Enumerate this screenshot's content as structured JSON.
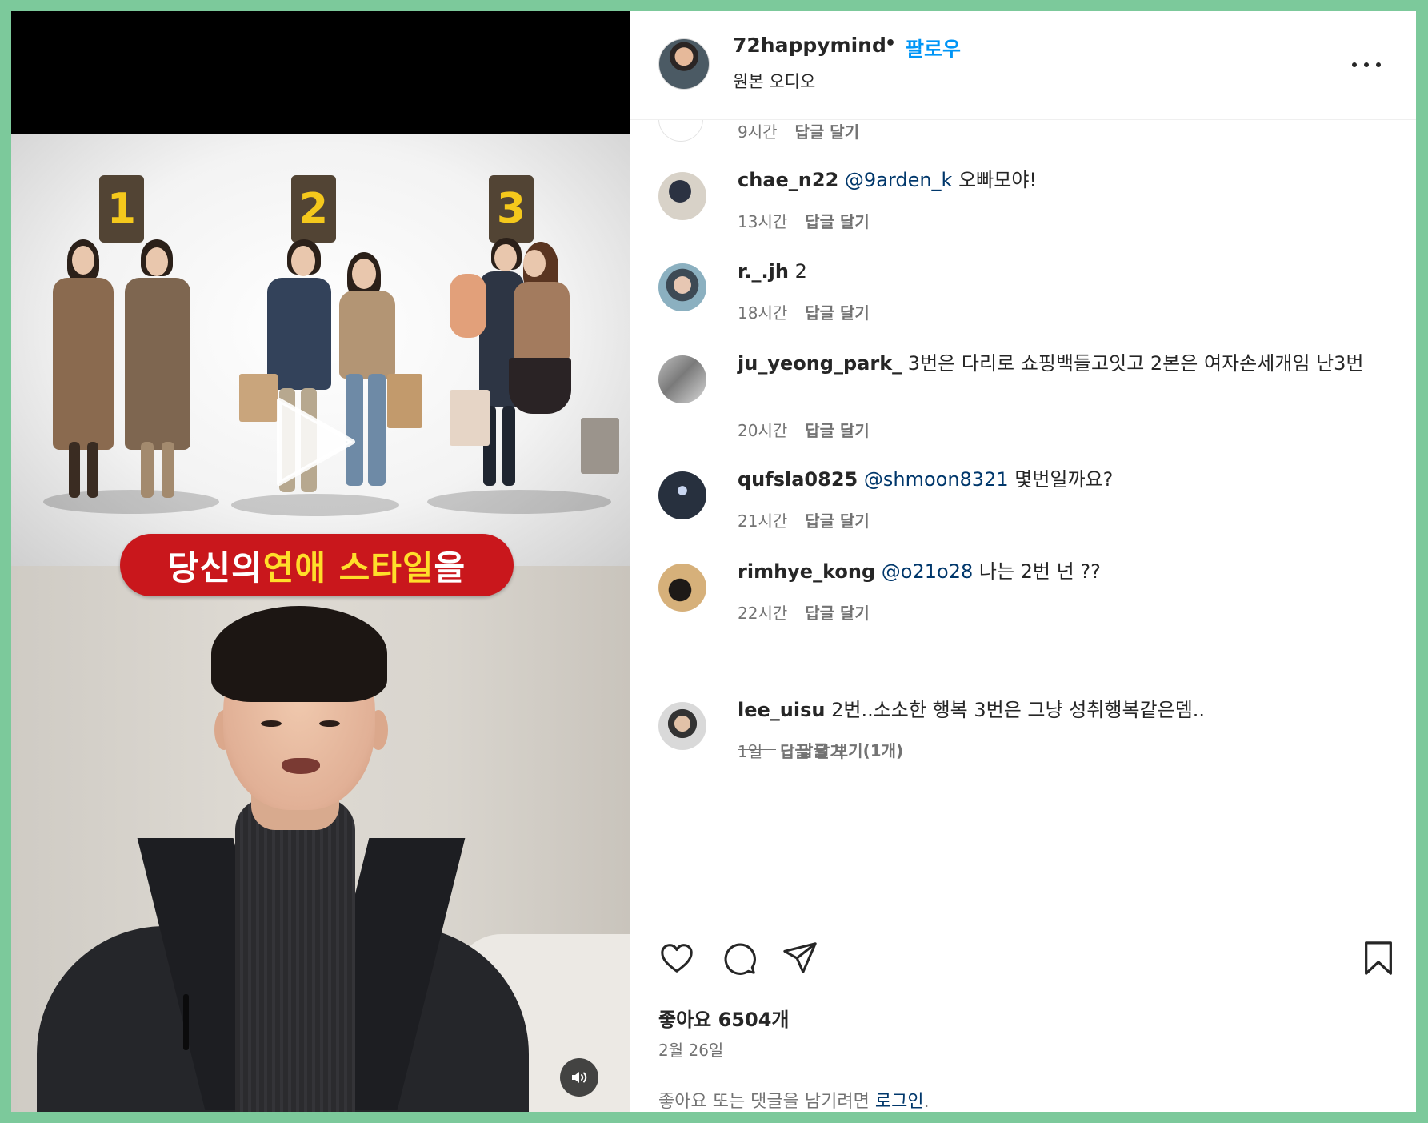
{
  "video": {
    "badges": [
      "1",
      "2",
      "3"
    ],
    "banner": {
      "part1": "당신의 ",
      "highlight": "연애 스타일",
      "part2": "을"
    }
  },
  "header": {
    "username": "72happymind",
    "separator": "•",
    "follow_label": "팔로우",
    "audio_label": "원본 오디오"
  },
  "comments": {
    "previous": {
      "time": "9시간",
      "reply_label": "답글 달기"
    },
    "items": [
      {
        "username": "chae_n22",
        "mention": "@9arden_k",
        "text": " 오빠모야!",
        "time": "13시간",
        "reply_label": "답글 달기"
      },
      {
        "username": "r._.jh",
        "mention": "",
        "text": " 2",
        "time": "18시간",
        "reply_label": "답글 달기"
      },
      {
        "username": "ju_yeong_park_",
        "mention": "",
        "text": " 3번은 다리로 쇼핑백들고잇고 2본은 여자손세개임 난3번",
        "time": "20시간",
        "reply_label": "답글 달기"
      },
      {
        "username": "qufsla0825",
        "mention": "@shmoon8321",
        "text": " 몇번일까요?",
        "time": "21시간",
        "reply_label": "답글 달기"
      },
      {
        "username": "rimhye_kong",
        "mention": "@o21o28",
        "text": " 나는 2번 넌 ??",
        "time": "22시간",
        "reply_label": "답글 달기"
      },
      {
        "username": "lee_uisu",
        "mention": "",
        "text": " 2번..소소한 행복 3번은 그냥 성취행복같은뎀..",
        "time": "1일",
        "reply_label": "답글 달기"
      }
    ],
    "view_replies_label": "답글 보기(1개)"
  },
  "actions": {
    "icons": [
      "heart-icon",
      "comment-icon",
      "share-icon",
      "bookmark-icon"
    ],
    "likes_label": "좋아요 6504개",
    "date": "2월 26일",
    "login_prompt": "좋아요 또는 댓글을 남기려면 ",
    "login_link": "로그인",
    "login_suffix": "."
  },
  "colors": {
    "follow_blue": "#0095f6",
    "mention_blue": "#00376b",
    "banner_red": "#c9171c",
    "banner_highlight": "#ffde2a",
    "badge_brown": "#524434",
    "badge_yellow": "#f4c81c",
    "outer_border": "#7cc99b"
  }
}
